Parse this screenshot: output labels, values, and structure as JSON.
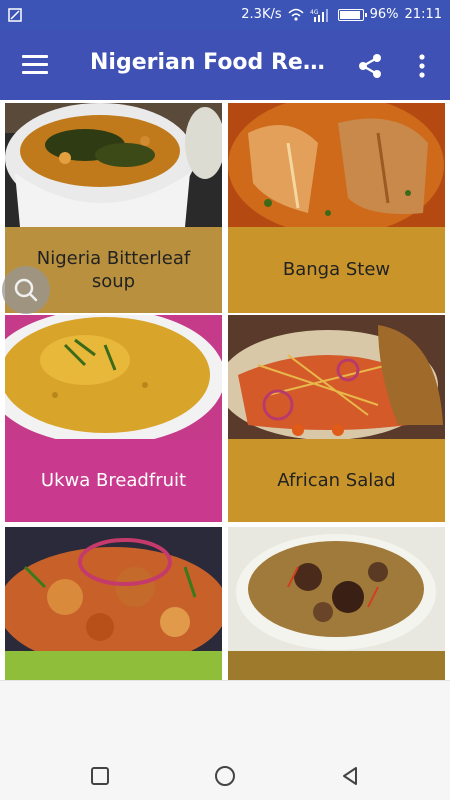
{
  "status_bar": {
    "speed": "2.3K/s",
    "battery_percent": "96%",
    "battery_level": 0.96,
    "time": "21:11"
  },
  "app_bar": {
    "title": "Nigerian Food Reci...",
    "menu_icon": "hamburger-menu-icon",
    "share_icon": "share-icon",
    "more_icon": "more-vert-icon"
  },
  "recipes": [
    {
      "name": "Nigeria Bitterleaf soup",
      "label_color": "#b9913e",
      "text_color": "#222222"
    },
    {
      "name": "Banga Stew",
      "label_color": "#c9952a",
      "text_color": "#222222"
    },
    {
      "name": "Ukwa Breadfruit",
      "label_color": "#c93a8e",
      "text_color": "#ffffff"
    },
    {
      "name": "African Salad",
      "label_color": "#c9952a",
      "text_color": "#222222"
    },
    {
      "name": "",
      "label_color": "#8fbf3a",
      "text_color": "#222222"
    },
    {
      "name": "",
      "label_color": "#9e7a2c",
      "text_color": "#222222"
    }
  ],
  "search_icon": "search-icon",
  "nav": {
    "recents_icon": "square-recents-icon",
    "home_icon": "circle-home-icon",
    "back_icon": "triangle-back-icon"
  },
  "colors": {
    "status_bar": "#3b54b5",
    "app_bar": "#3f51b5"
  }
}
